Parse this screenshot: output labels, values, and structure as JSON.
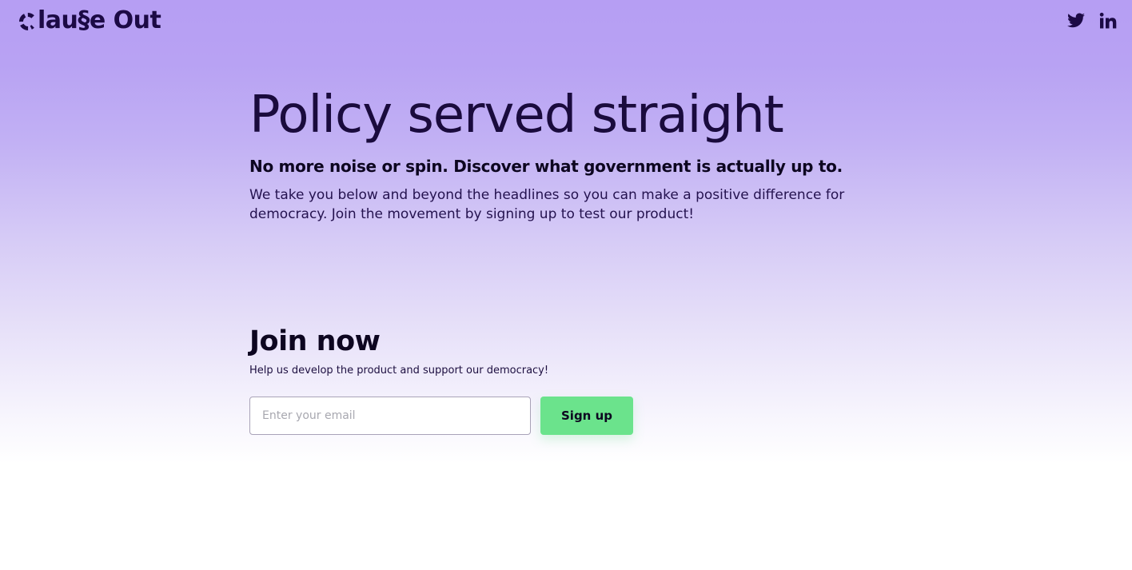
{
  "header": {
    "logo_text": "lau§e Out",
    "social": [
      {
        "name": "twitter",
        "icon": "twitter-icon"
      },
      {
        "name": "linkedin",
        "icon": "linkedin-icon"
      }
    ]
  },
  "hero": {
    "title": "Policy served straight",
    "subtitle": "No more noise or spin. Discover what government is actually up to.",
    "body": "We take you below and beyond the headlines so you can make a positive difference for democracy. Join the movement by signing up to test our product!"
  },
  "join": {
    "title": "Join now",
    "text": "Help us develop the product and support our democracy!",
    "email_placeholder": "Enter your email",
    "email_value": "",
    "button_label": "Sign up"
  },
  "colors": {
    "brand_dark": "#1c0a45",
    "gradient_top": "#b69ef3",
    "button_green": "#6be38c"
  }
}
